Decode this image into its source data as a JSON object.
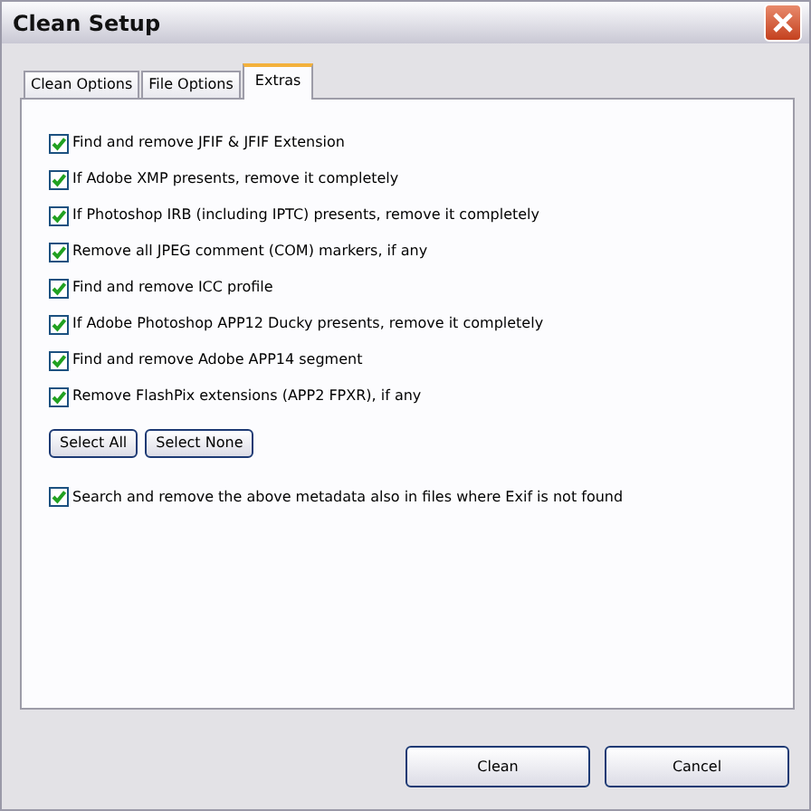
{
  "window": {
    "title": "Clean Setup"
  },
  "tabs": [
    {
      "label": "Clean Options",
      "selected": false
    },
    {
      "label": "File Options",
      "selected": false
    },
    {
      "label": "Extras",
      "selected": true
    }
  ],
  "options": [
    {
      "label": "Find and remove JFIF & JFIF Extension",
      "checked": true
    },
    {
      "label": "If Adobe XMP presents, remove it completely",
      "checked": true
    },
    {
      "label": "If Photoshop IRB (including IPTC) presents, remove it completely",
      "checked": true
    },
    {
      "label": "Remove all JPEG comment (COM) markers, if any",
      "checked": true
    },
    {
      "label": "Find and remove ICC profile",
      "checked": true
    },
    {
      "label": "If Adobe Photoshop APP12 Ducky presents, remove it completely",
      "checked": true
    },
    {
      "label": "Find and remove Adobe APP14 segment",
      "checked": true
    },
    {
      "label": "Remove FlashPix extensions (APP2 FPXR), if any",
      "checked": true
    }
  ],
  "select_buttons": [
    "Select All",
    "Select None"
  ],
  "search_option": {
    "label": "Search and remove the above metadata also in files where Exif is not found",
    "checked": true
  },
  "buttons": [
    "Clean",
    "Cancel"
  ]
}
